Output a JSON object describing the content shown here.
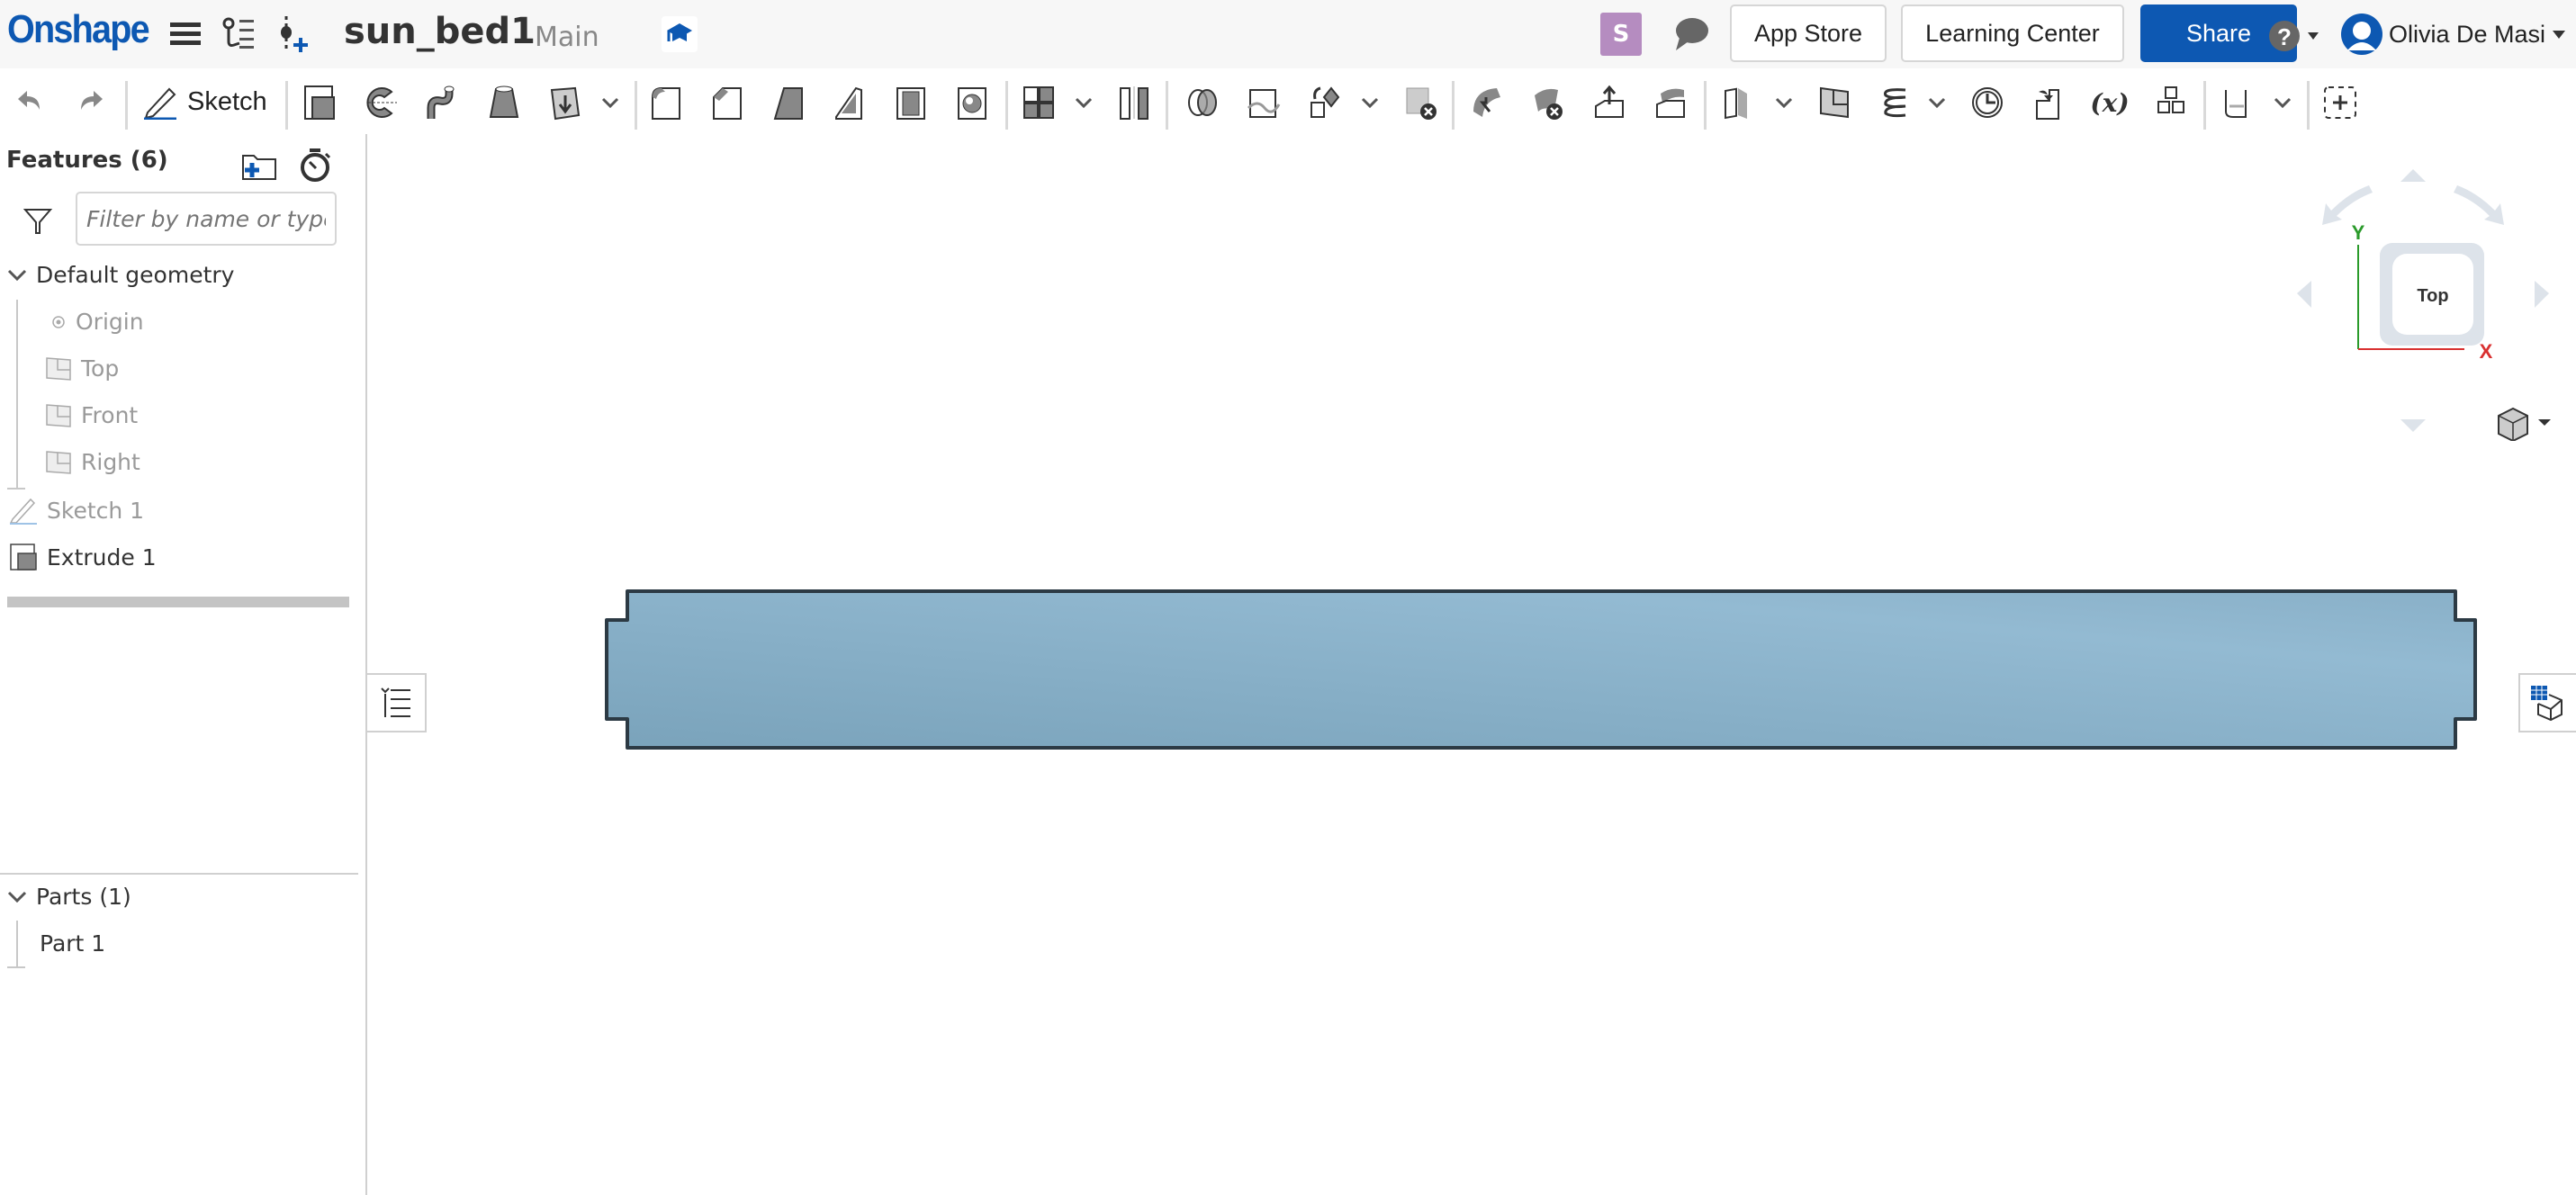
{
  "header": {
    "logo": "Onshape",
    "document_title": "sun_bed1",
    "branch": "Main",
    "collaborator_initial": "S",
    "collaborator_color": "#b58cc0",
    "app_store_label": "App Store",
    "learning_center_label": "Learning Center",
    "share_label": "Share",
    "user_name": "Olivia De Masi",
    "brand_color": "#0d58b2"
  },
  "toolbar": {
    "sketch_label": "Sketch",
    "tools": [
      "extrude",
      "revolve",
      "sweep",
      "loft",
      "thicken",
      "fillet",
      "chamfer",
      "draft",
      "rib",
      "shell",
      "hole",
      "linear-pattern",
      "mirror",
      "boolean",
      "split",
      "transform",
      "delete-part",
      "modify-fillet",
      "delete-face",
      "move-face",
      "replace-face",
      "offset-surface",
      "plane",
      "helix",
      "circle-tool",
      "insert-part",
      "variable",
      "derived",
      "sheet-metal",
      "add-custom-feature"
    ]
  },
  "features_panel": {
    "title": "Features (6)",
    "filter_placeholder": "Filter by name or type",
    "default_geometry_label": "Default geometry",
    "default_items": [
      {
        "label": "Origin",
        "icon": "origin-icon"
      },
      {
        "label": "Top",
        "icon": "plane-icon"
      },
      {
        "label": "Front",
        "icon": "plane-icon"
      },
      {
        "label": "Right",
        "icon": "plane-icon"
      }
    ],
    "features": [
      {
        "label": "Sketch 1",
        "icon": "sketch-icon",
        "state": "muted"
      },
      {
        "label": "Extrude 1",
        "icon": "extrude-icon",
        "state": "active"
      }
    ],
    "parts_label": "Parts (1)",
    "parts": [
      {
        "label": "Part 1"
      }
    ]
  },
  "viewport": {
    "view_label": "Top",
    "axis_x": "X",
    "axis_y": "Y",
    "part_color": "#7aa3bb"
  }
}
